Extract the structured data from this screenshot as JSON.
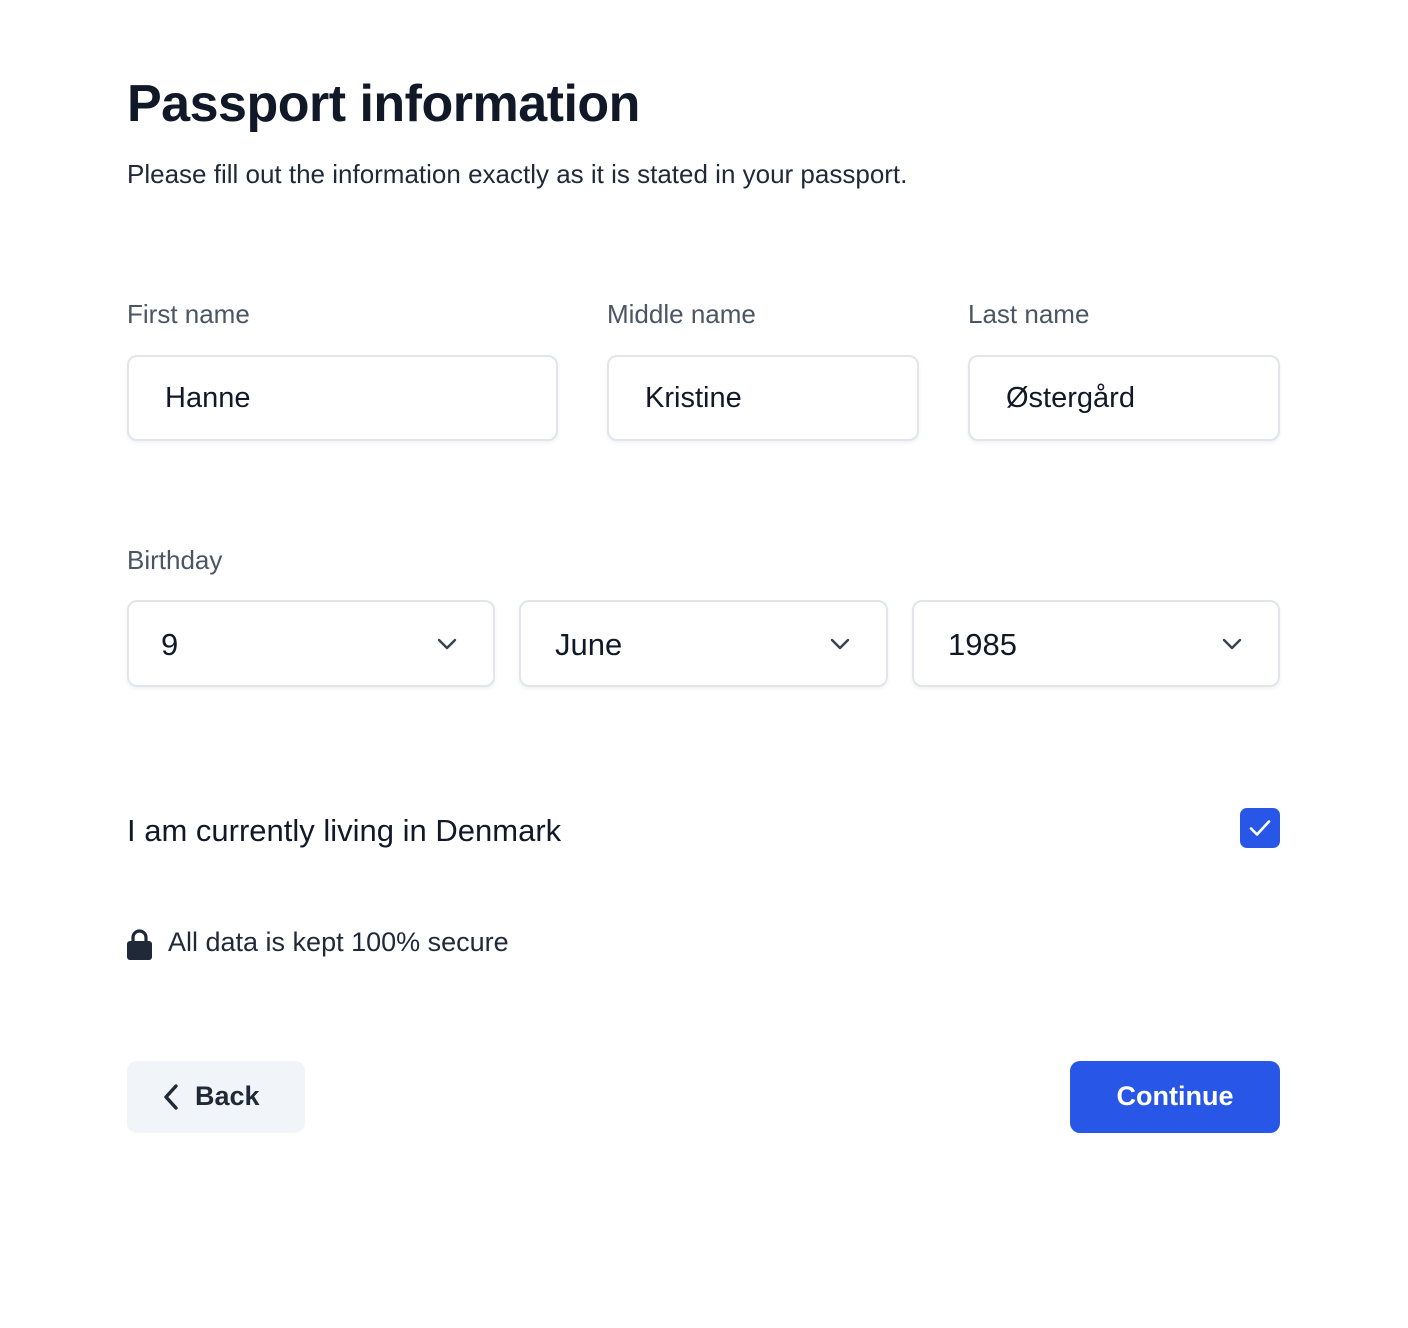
{
  "header": {
    "title": "Passport information",
    "subtitle": "Please fill out the information exactly as it is stated in your passport."
  },
  "name_fields": {
    "first": {
      "label": "First name",
      "value": "Hanne"
    },
    "middle": {
      "label": "Middle name",
      "value": "Kristine"
    },
    "last": {
      "label": "Last name",
      "value": "Østergård"
    }
  },
  "birthday": {
    "label": "Birthday",
    "day": "9",
    "month": "June",
    "year": "1985",
    "dropdown_icon": "chevron-down-icon"
  },
  "residence": {
    "label": "I am currently living in Denmark",
    "checked": true,
    "check_icon": "checkmark-icon"
  },
  "security_note": {
    "icon": "lock-icon",
    "text": "All data is kept 100% secure"
  },
  "actions": {
    "back_label": "Back",
    "back_icon": "chevron-left-icon",
    "continue_label": "Continue"
  },
  "colors": {
    "accent": "#2857e8",
    "title_text": "#111827",
    "label_text": "#4b5563",
    "input_border": "#e2e5ea",
    "back_button_bg": "#f1f4f8"
  }
}
